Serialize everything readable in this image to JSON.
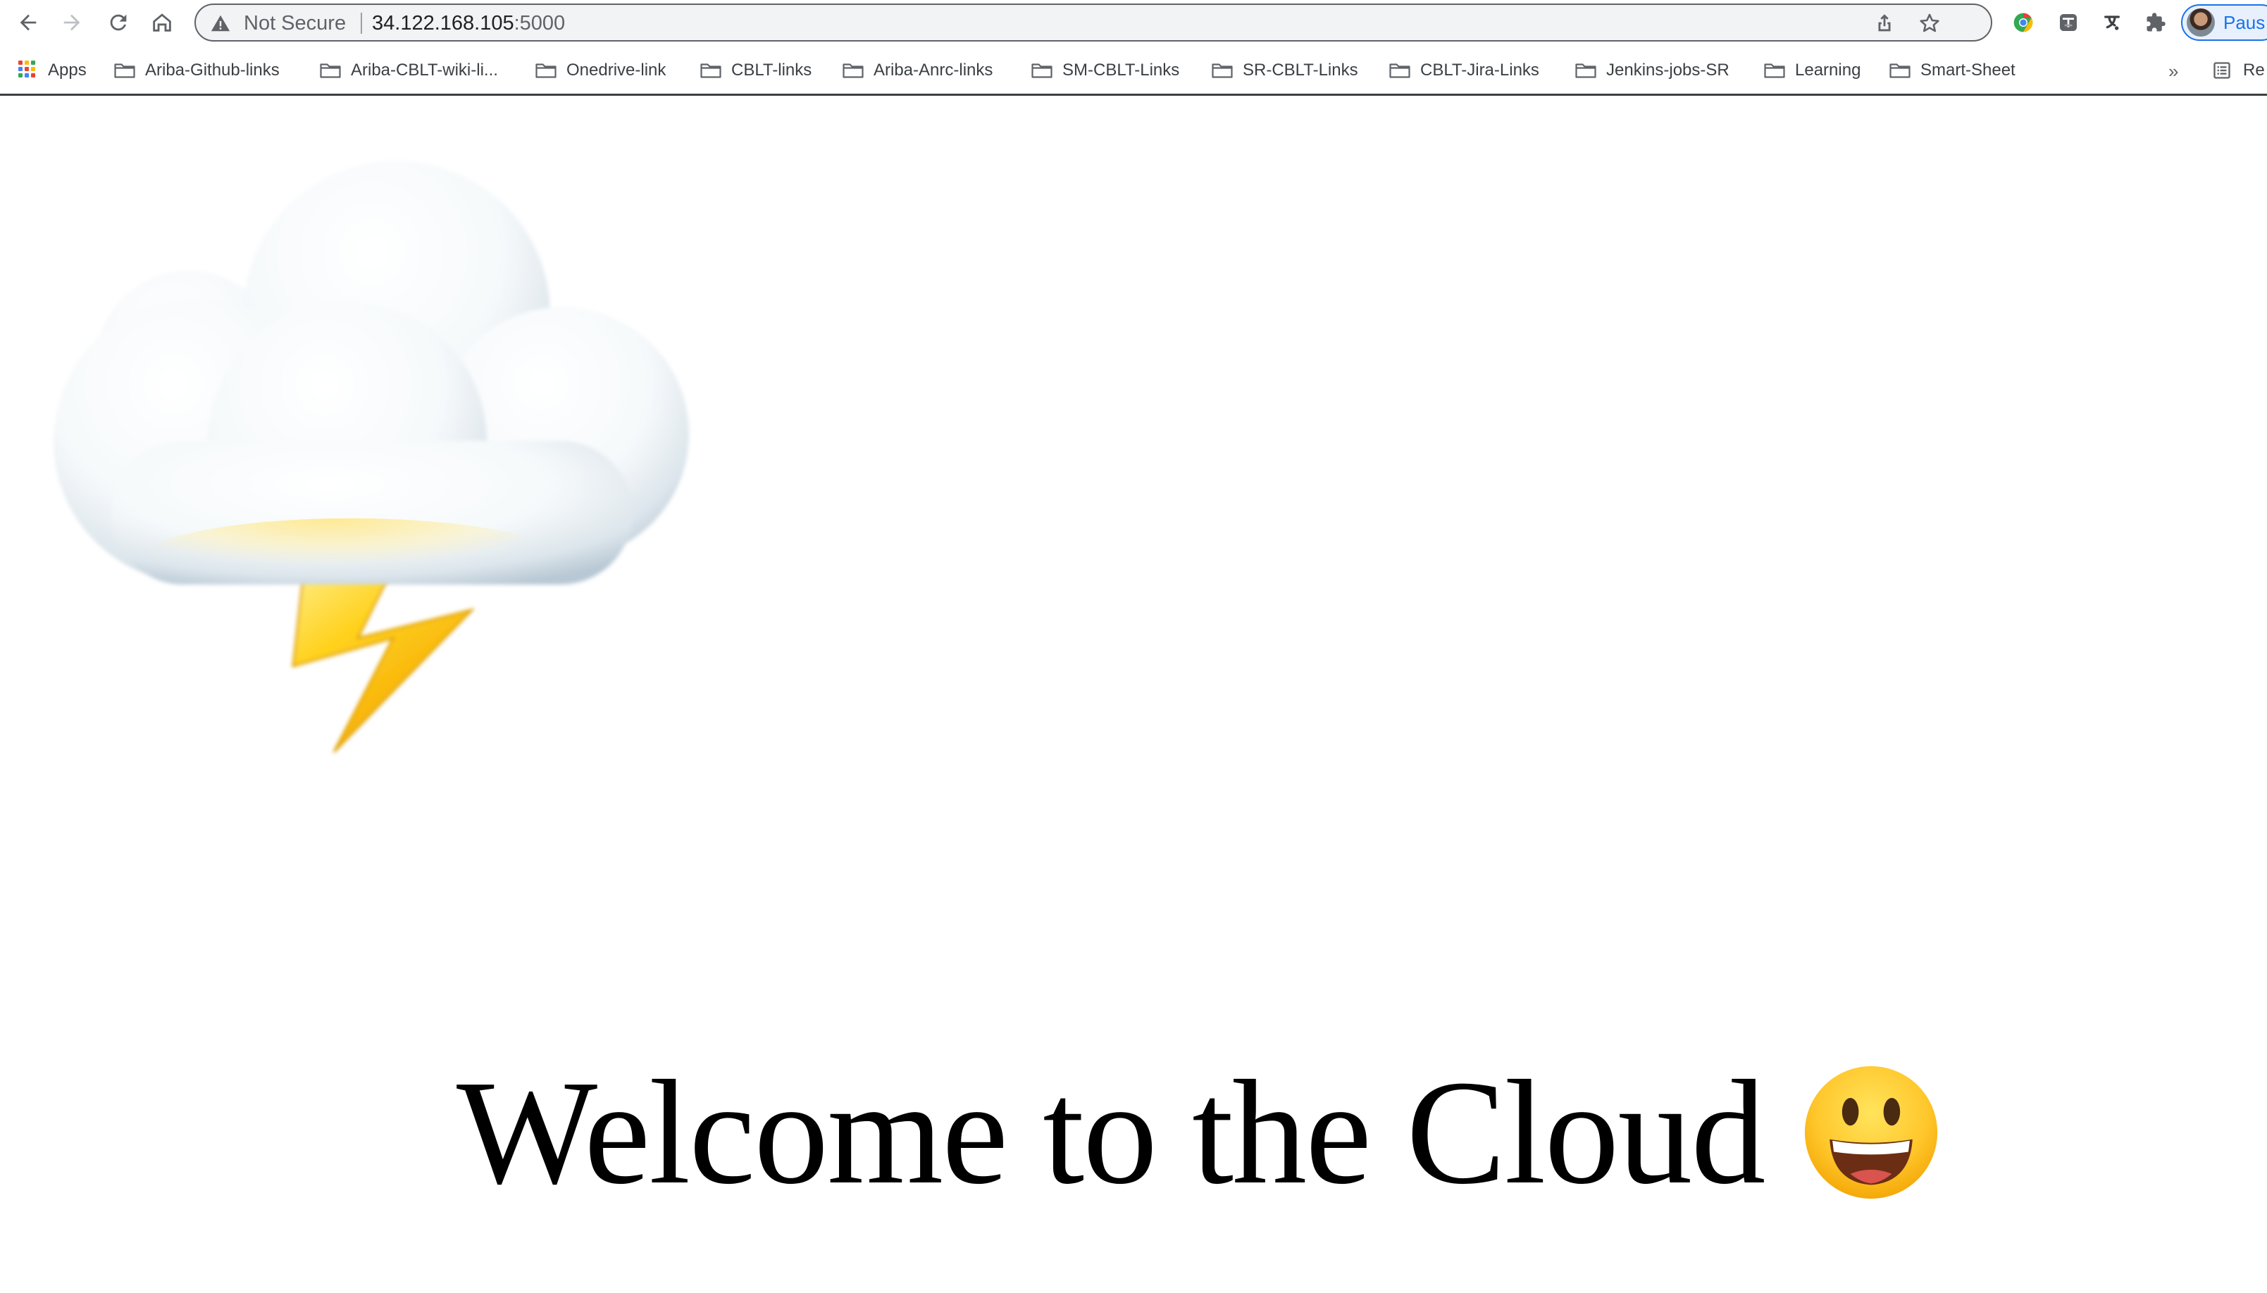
{
  "browser": {
    "security_label": "Not Secure",
    "url_host": "34.122.168.105",
    "url_port": ":5000",
    "profile_label": "Paus",
    "nav": {
      "back_icon": "arrow-left-icon",
      "forward_icon": "arrow-right-icon",
      "reload_icon": "reload-icon",
      "home_icon": "home-icon"
    },
    "omnibox_icons": [
      "share-icon",
      "star-icon"
    ],
    "extensions": [
      "chrome-extension-icon",
      "translate-extension-icon",
      "grammar-extension-icon",
      "puzzle-icon"
    ],
    "colors": {
      "profile_accent": "#1a73e8",
      "omnibox_bg": "#f1f3f4"
    }
  },
  "bookmarks": {
    "apps_label": "Apps",
    "items": [
      "Ariba-Github-links",
      "Ariba-CBLT-wiki-li...",
      "Onedrive-link",
      "CBLT-links",
      "Ariba-Anrc-links",
      "SM-CBLT-Links",
      "SR-CBLT-Links",
      "CBLT-Jira-Links",
      "Jenkins-jobs-SR",
      "Learning",
      "Smart-Sheet"
    ],
    "overflow_label": "»",
    "reading_list_label": "Re"
  },
  "page": {
    "image_icon": "cloud-with-lightning-icon",
    "heading": "Welcome to the Cloud",
    "heading_emoji": "grinning-face-icon"
  }
}
